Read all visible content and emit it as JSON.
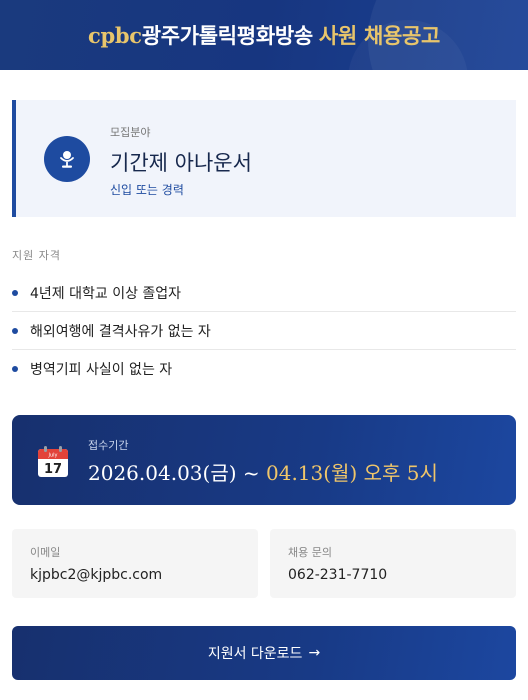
{
  "header": {
    "brand": "cpbc",
    "station": "광주가톨릭평화방송",
    "title_rest": "사원 채용공고"
  },
  "position": {
    "label": "모집분야",
    "title": "기간제 아나운서",
    "subtitle": "신입 또는 경력",
    "icon": "microphone-icon"
  },
  "qualifications": {
    "heading": "지원 자격",
    "items": [
      "4년제 대학교 이상 졸업자",
      "해외여행에 결격사유가 없는 자",
      "병역기피 사실이 없는 자"
    ]
  },
  "period": {
    "label": "접수기간",
    "start": "2026.04.03(금) ~ ",
    "end": "04.13(월) 오후 5시",
    "calendar_month": "July",
    "calendar_day": "17",
    "end_color": "#f0c66a"
  },
  "contact": {
    "email_label": "이메일",
    "email": "kjpbc2@kjpbc.com",
    "phone_label": "채용 문의",
    "phone": "062-231-7710"
  },
  "download": {
    "label": "지원서 다운로드",
    "arrow": "→"
  },
  "colors": {
    "primary": "#1e4ba0",
    "navy": "#17306e",
    "gold": "#e8c56b",
    "card_bg": "#f1f4fb"
  }
}
